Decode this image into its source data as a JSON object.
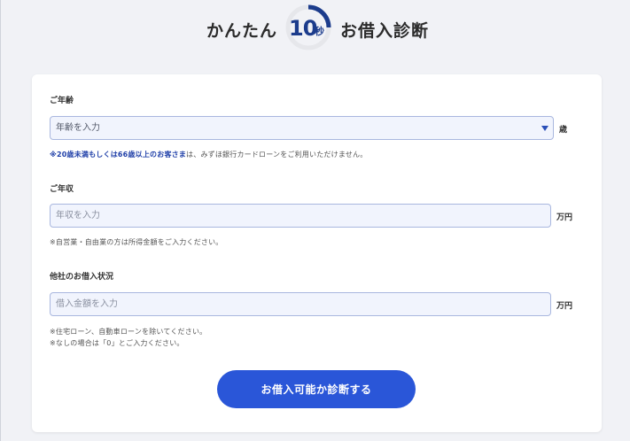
{
  "header": {
    "prefix": "かんたん",
    "timer_number": "10",
    "timer_unit": "秒",
    "suffix": "お借入診断",
    "timer_progress": 0.25,
    "colors": {
      "accent": "#1c3c8c",
      "ring": "#e6e7eb",
      "ring_fill": "#1c3c8c"
    }
  },
  "form": {
    "age": {
      "label": "ご年齢",
      "selected_value": "年齢を入力",
      "unit": "歳",
      "note_highlight": "※20歳未満もしくは66歳以上のお客さま",
      "note_rest": "は、みずほ銀行カードローンをご利用いただけません。"
    },
    "income": {
      "label": "ご年収",
      "placeholder": "年収を入力",
      "unit": "万円",
      "note": "※自営業・自由業の方は所得金額をご入力ください。"
    },
    "other_loans": {
      "label": "他社のお借入状況",
      "placeholder": "借入金額を入力",
      "unit": "万円",
      "note_line1": "※住宅ローン、自動車ローンを除いてください。",
      "note_line2": "※なしの場合は「0」とご入力ください。"
    },
    "submit_label": "お借入可能か診断する",
    "colors": {
      "button": "#2a56d8",
      "field_bg": "#f1f4fd",
      "field_border": "#a9b7df"
    }
  }
}
